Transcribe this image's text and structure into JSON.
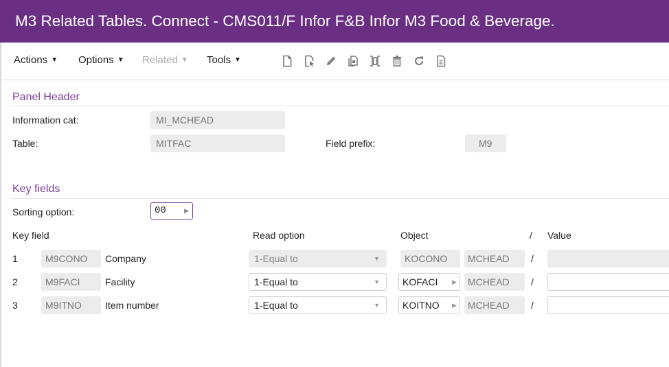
{
  "window": {
    "title": "M3 Related Tables. Connect - CMS011/F   Infor F&B Infor M3 Food & Beverage."
  },
  "toolbar": {
    "menus": [
      {
        "label": "Actions",
        "enabled": true
      },
      {
        "label": "Options",
        "enabled": true
      },
      {
        "label": "Related",
        "enabled": false
      },
      {
        "label": "Tools",
        "enabled": true
      }
    ],
    "icons": [
      "new-icon",
      "select-icon",
      "edit-icon",
      "copy-icon",
      "duplicate-icon",
      "delete-icon",
      "refresh-icon",
      "document-icon"
    ]
  },
  "panel_header": {
    "title": "Panel Header",
    "info_cat_label": "Information cat:",
    "info_cat_value": "MI_MCHEAD",
    "table_label": "Table:",
    "table_value": "MITFAC",
    "field_prefix_label": "Field prefix:",
    "field_prefix_value": "M9"
  },
  "key_fields": {
    "title": "Key fields",
    "sorting_label": "Sorting option:",
    "sorting_value": "00",
    "columns": {
      "key_field": "Key field",
      "read_option": "Read option",
      "object": "Object",
      "slash": "/",
      "value": "Value"
    },
    "rows": [
      {
        "num": "1",
        "field": "M9CONO",
        "desc": "Company",
        "read_option": "1-Equal to",
        "object": "KOCONO",
        "file": "MCHEAD",
        "slash": "/",
        "value": "",
        "editable": false
      },
      {
        "num": "2",
        "field": "M9FACI",
        "desc": "Facility",
        "read_option": "1-Equal to",
        "object": "KOFACI",
        "file": "MCHEAD",
        "slash": "/",
        "value": "",
        "editable": true
      },
      {
        "num": "3",
        "field": "M9ITNO",
        "desc": "Item number",
        "read_option": "1-Equal to",
        "object": "KOITNO",
        "file": "MCHEAD",
        "slash": "/",
        "value": "",
        "editable": true
      }
    ]
  }
}
